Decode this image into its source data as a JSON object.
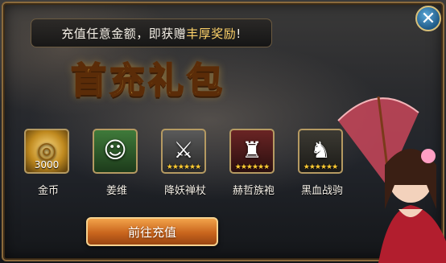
{
  "banner": {
    "prefix": "充值任意金额，即获赠",
    "highlight": "丰厚奖励",
    "suffix": "!"
  },
  "title": "首充礼包",
  "close_icon": "close-icon",
  "rewards": [
    {
      "label": "金币",
      "quantity": "3000",
      "icon": "gold-coin-icon",
      "stars": ""
    },
    {
      "label": "姜维",
      "quantity": "",
      "icon": "hero-portrait-icon",
      "stars": ""
    },
    {
      "label": "降妖禅杖",
      "quantity": "",
      "icon": "staff-weapon-icon",
      "stars": "★★★★★★"
    },
    {
      "label": "赫哲族袍",
      "quantity": "",
      "icon": "robe-armor-icon",
      "stars": "★★★★★★"
    },
    {
      "label": "黑血战驹",
      "quantity": "",
      "icon": "war-horse-icon",
      "stars": "★★★★★★"
    }
  ],
  "button": {
    "label": "前往充值"
  },
  "colors": {
    "highlight": "#ffd36a",
    "title": "#f6c84a",
    "button": "#c9651d"
  }
}
